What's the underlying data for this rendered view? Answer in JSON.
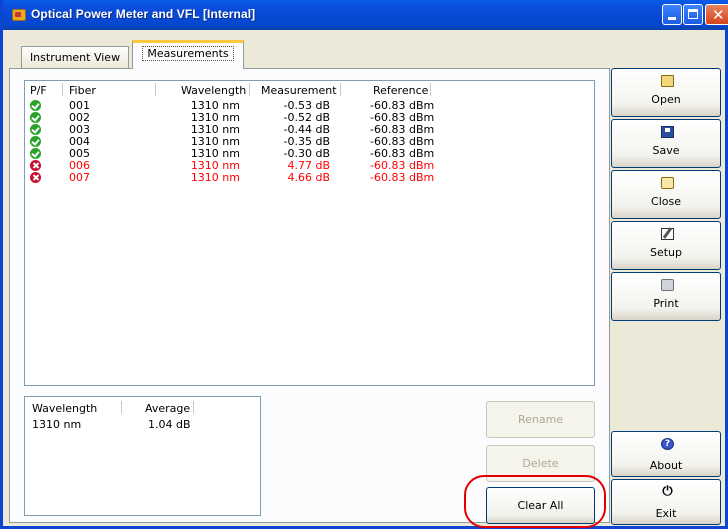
{
  "window": {
    "title": "Optical Power Meter and VFL [Internal]"
  },
  "tabs": [
    {
      "label": "Instrument View"
    },
    {
      "label": "Measurements"
    }
  ],
  "list": {
    "columns": [
      "P/F",
      "Fiber",
      "Wavelength",
      "Measurement",
      "Reference"
    ],
    "rows": [
      {
        "status": "pass",
        "fiber": "001",
        "wavelength": "1310 nm",
        "measurement": "-0.53 dB",
        "reference": "-60.83 dBm"
      },
      {
        "status": "pass",
        "fiber": "002",
        "wavelength": "1310 nm",
        "measurement": "-0.52 dB",
        "reference": "-60.83 dBm"
      },
      {
        "status": "pass",
        "fiber": "003",
        "wavelength": "1310 nm",
        "measurement": "-0.44 dB",
        "reference": "-60.83 dBm"
      },
      {
        "status": "pass",
        "fiber": "004",
        "wavelength": "1310 nm",
        "measurement": "-0.35 dB",
        "reference": "-60.83 dBm"
      },
      {
        "status": "pass",
        "fiber": "005",
        "wavelength": "1310 nm",
        "measurement": "-0.30 dB",
        "reference": "-60.83 dBm"
      },
      {
        "status": "fail",
        "fiber": "006",
        "wavelength": "1310 nm",
        "measurement": "4.77 dB",
        "reference": "-60.83 dBm"
      },
      {
        "status": "fail",
        "fiber": "007",
        "wavelength": "1310 nm",
        "measurement": "4.66 dB",
        "reference": "-60.83 dBm"
      }
    ]
  },
  "summary": {
    "columns": [
      "Wavelength",
      "Average"
    ],
    "rows": [
      {
        "wavelength": "1310 nm",
        "average": "1.04 dB"
      }
    ]
  },
  "actions": {
    "rename": "Rename",
    "delete": "Delete",
    "clear_all": "Clear All"
  },
  "sidebar": {
    "open": "Open",
    "save": "Save",
    "close": "Close",
    "setup": "Setup",
    "print": "Print",
    "about": "About",
    "exit": "Exit"
  },
  "colors": {
    "fail_text": "#ff0000",
    "pass_icon": "#2aa22a",
    "fail_icon": "#c8102e",
    "highlight": "#e00000"
  }
}
